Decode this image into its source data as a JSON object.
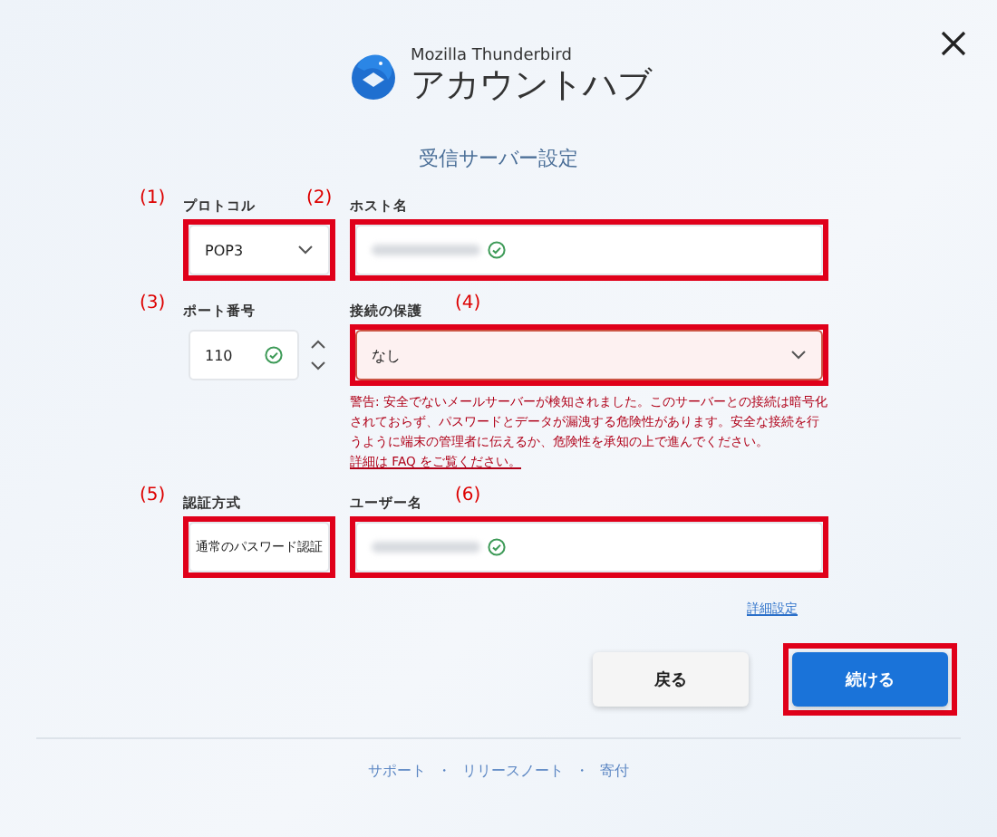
{
  "header": {
    "product": "Mozilla Thunderbird",
    "title": "アカウントハブ"
  },
  "section_title": "受信サーバー設定",
  "fields": [
    {
      "kind": "select",
      "label": "プロトコル",
      "value": "POP3",
      "callout": "(1)",
      "callout_after": false,
      "highlighted": true,
      "valid": false
    },
    {
      "kind": "text",
      "label": "ホスト名",
      "callout": "(2)",
      "callout_after": false,
      "highlighted": true,
      "valid": true
    },
    {
      "kind": "number",
      "label": "ポート番号",
      "value": "110",
      "callout": "(3)",
      "callout_after": false,
      "highlighted": false,
      "valid": true
    },
    {
      "kind": "select",
      "label": "接続の保護",
      "value": "なし",
      "callout": "(4)",
      "callout_after": true,
      "highlighted": true,
      "valid": false
    },
    {
      "kind": "select",
      "label": "認証方式",
      "value": "通常のパスワード認証",
      "callout": "(5)",
      "callout_after": false,
      "highlighted": true,
      "valid": false
    },
    {
      "kind": "text",
      "label": "ユーザー名",
      "callout": "(6)",
      "callout_after": true,
      "highlighted": true,
      "valid": true
    }
  ],
  "warning": {
    "text": "警告: 安全でないメールサーバーが検知されました。このサーバーとの接続は暗号化されておらず、パスワードとデータが漏洩する危険性があります。安全な接続を行うように端末の管理者に伝えるか、危険性を承知の上で進んでください。",
    "link": "詳細は FAQ をご覧ください。"
  },
  "advanced_link": "詳細設定",
  "buttons": [
    {
      "label": "戻る",
      "kind": "secondary",
      "highlighted": false
    },
    {
      "label": "続ける",
      "kind": "primary",
      "highlighted": true
    }
  ],
  "footer_links": [
    "サポート",
    "リリースノート",
    "寄付"
  ],
  "footer_separator": "・"
}
